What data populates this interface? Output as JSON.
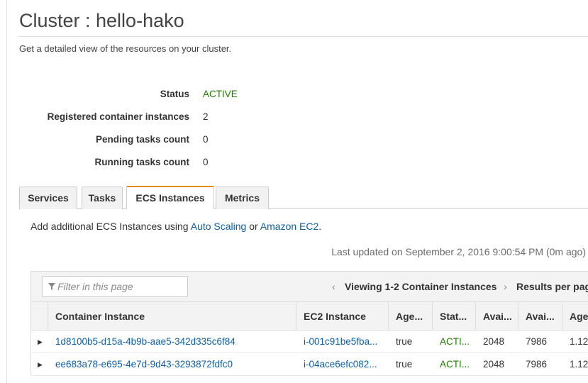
{
  "header": {
    "title": "Cluster : hello-hako",
    "subtitle": "Get a detailed view of the resources on your cluster."
  },
  "summary": [
    {
      "label": "Status",
      "value": "ACTIVE"
    },
    {
      "label": "Registered container instances",
      "value": "2"
    },
    {
      "label": "Pending tasks count",
      "value": "0"
    },
    {
      "label": "Running tasks count",
      "value": "0"
    }
  ],
  "tabs": [
    {
      "label": "Services"
    },
    {
      "label": "Tasks"
    },
    {
      "label": "ECS Instances",
      "active": true
    },
    {
      "label": "Metrics"
    }
  ],
  "info": {
    "prefix": "Add additional ECS Instances using ",
    "link1": "Auto Scaling",
    "middle": " or ",
    "link2": "Amazon EC2",
    "suffix": "."
  },
  "last_updated": "Last updated on September 2, 2016 9:00:54 PM (0m ago)",
  "toolbar": {
    "filter_placeholder": "Filter in this page",
    "prev_icon": "chevron-left-icon",
    "next_icon": "chevron-right-icon",
    "viewing": "Viewing 1-2 Container Instances",
    "results_per_page": "Results per pag"
  },
  "table": {
    "columns": [
      "Container Instance",
      "EC2 Instance",
      "Age...",
      "Stat...",
      "Avai...",
      "Avai...",
      "Age"
    ],
    "rows": [
      [
        "1d8100b5-d15a-4b9b-aae5-342d335c6f84",
        "i-001c91be5fba...",
        "true",
        "ACTI...",
        "2048",
        "7986",
        "1.12"
      ],
      [
        "ee683a78-e695-4e7d-9d43-3293872fdfc0",
        "i-04ace6efc082...",
        "true",
        "ACTI...",
        "2048",
        "7986",
        "1.12"
      ]
    ]
  },
  "colors": {
    "active_status": "#1d8102",
    "link": "#0d5fa6",
    "active_tab_accent": "#e28d0b"
  }
}
